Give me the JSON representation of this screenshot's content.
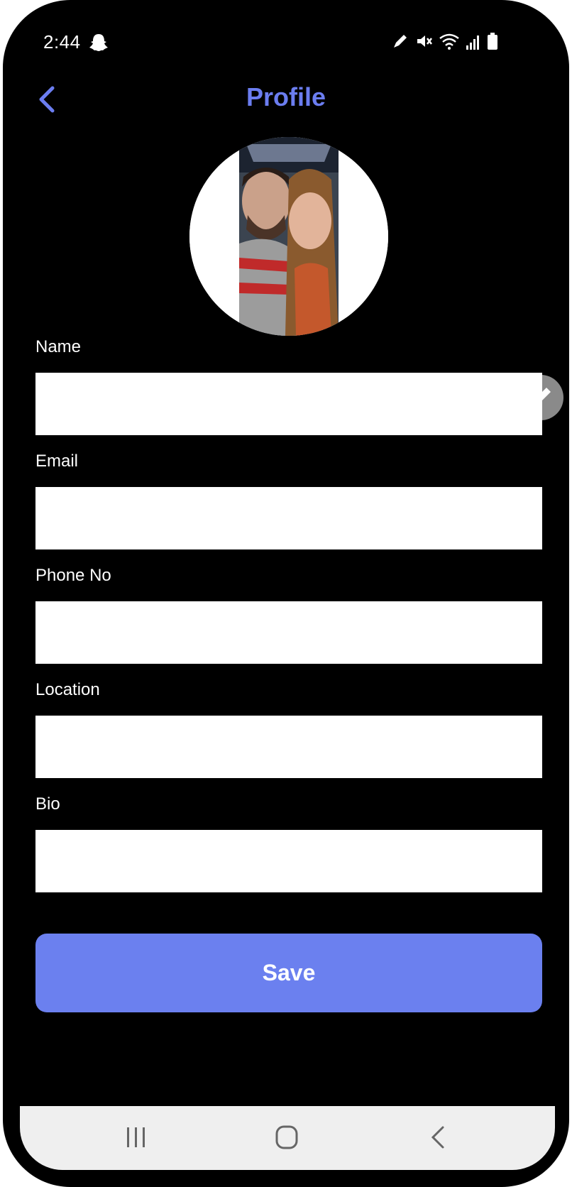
{
  "status_bar": {
    "time": "2:44",
    "icons": [
      "snapchat-ghost-icon",
      "pen-icon",
      "mute-icon",
      "wifi-icon",
      "signal-icon",
      "battery-icon"
    ]
  },
  "header": {
    "title": "Profile",
    "back_icon": "chevron-left-icon"
  },
  "profile": {
    "edit_icon": "pencil-icon"
  },
  "form": {
    "fields": [
      {
        "label": "Name",
        "value": "",
        "placeholder": ""
      },
      {
        "label": "Email",
        "value": "",
        "placeholder": ""
      },
      {
        "label": "Phone No",
        "value": "",
        "placeholder": ""
      },
      {
        "label": "Location",
        "value": "",
        "placeholder": ""
      },
      {
        "label": "Bio",
        "value": "",
        "placeholder": ""
      }
    ],
    "save_label": "Save"
  },
  "nav": {
    "items": [
      "recent-apps-icon",
      "home-icon",
      "back-icon"
    ]
  },
  "colors": {
    "accent": "#6b7df0",
    "save_button": "#6b80ef",
    "background": "#000000",
    "input_background": "#ffffff",
    "nav_background": "#efefef"
  }
}
